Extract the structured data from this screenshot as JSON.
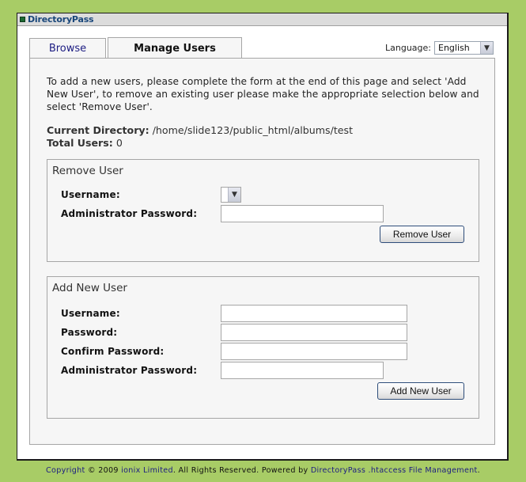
{
  "window": {
    "title": "DirectoryPass"
  },
  "tabs": [
    {
      "label": "Browse",
      "active": false
    },
    {
      "label": "Manage Users",
      "active": true
    }
  ],
  "language": {
    "label": "Language:",
    "selected": "English"
  },
  "intro": "To add a new users, please complete the form at the end of this page and select 'Add New User', to remove an existing user please make the appropriate selection below and select 'Remove User'.",
  "meta": {
    "current_directory_label": "Current Directory:",
    "current_directory_value": "/home/slide123/public_html/albums/test",
    "total_users_label": "Total Users:",
    "total_users_value": "0"
  },
  "remove_user": {
    "title": "Remove User",
    "username_label": "Username:",
    "username_selected": "",
    "admin_password_label": "Administrator Password:",
    "admin_password_value": "",
    "button_label": "Remove User"
  },
  "add_user": {
    "title": "Add New User",
    "username_label": "Username:",
    "username_value": "",
    "password_label": "Password:",
    "password_value": "",
    "confirm_password_label": "Confirm Password:",
    "confirm_password_value": "",
    "admin_password_label": "Administrator Password:",
    "admin_password_value": "",
    "button_label": "Add New User"
  },
  "footer": {
    "copyright": "Copyright",
    "symbol_year": " © 2009 ",
    "company": "ionix Limited",
    "rights": ". All Rights Reserved.  Powered by ",
    "product": "DirectoryPass .htaccess File Management",
    "end": "."
  },
  "colors": {
    "background": "#a8cc66",
    "link": "#1c1c82",
    "title_text": "#18467a",
    "title_icon": "#1c6a33"
  },
  "icons": {
    "title": "square-icon",
    "dropdown": "chevron-down-icon"
  }
}
